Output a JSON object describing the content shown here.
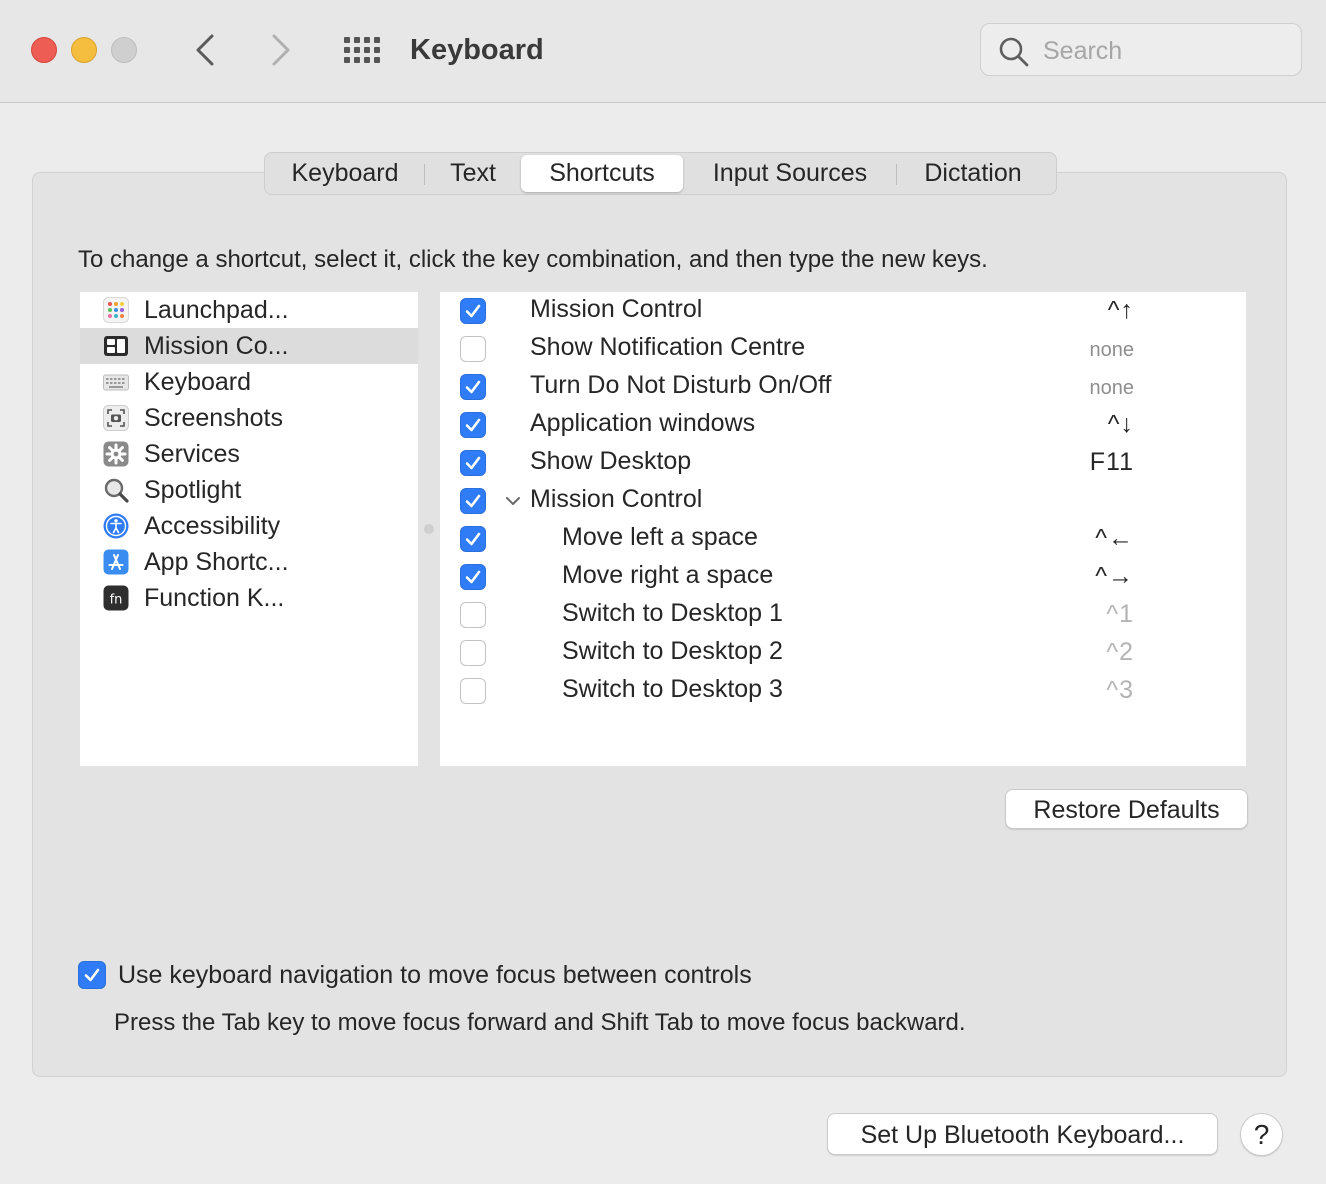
{
  "window": {
    "title": "Keyboard",
    "search_placeholder": "Search"
  },
  "tabs": [
    {
      "label": "Keyboard",
      "active": false
    },
    {
      "label": "Text",
      "active": false
    },
    {
      "label": "Shortcuts",
      "active": true
    },
    {
      "label": "Input Sources",
      "active": false
    },
    {
      "label": "Dictation",
      "active": false
    }
  ],
  "instructions": "To change a shortcut, select it, click the key combination, and then type the new keys.",
  "categories": [
    {
      "label": "Launchpad...",
      "icon": "launchpad-icon",
      "selected": false
    },
    {
      "label": "Mission Co...",
      "icon": "mission-control-icon",
      "selected": true
    },
    {
      "label": "Keyboard",
      "icon": "keyboard-icon",
      "selected": false
    },
    {
      "label": "Screenshots",
      "icon": "screenshot-icon",
      "selected": false
    },
    {
      "label": "Services",
      "icon": "gear-icon",
      "selected": false
    },
    {
      "label": "Spotlight",
      "icon": "magnifier-icon",
      "selected": false
    },
    {
      "label": "Accessibility",
      "icon": "accessibility-icon",
      "selected": false
    },
    {
      "label": "App Shortc...",
      "icon": "app-store-icon",
      "selected": false
    },
    {
      "label": "Function K...",
      "icon": "fn-key-icon",
      "selected": false
    }
  ],
  "shortcuts": [
    {
      "label": "Mission Control",
      "key": "^↑",
      "checked": true,
      "indent": false,
      "group": false,
      "style": "normal"
    },
    {
      "label": "Show Notification Centre",
      "key": "none",
      "checked": false,
      "indent": false,
      "group": false,
      "style": "none"
    },
    {
      "label": "Turn Do Not Disturb On/Off",
      "key": "none",
      "checked": true,
      "indent": false,
      "group": false,
      "style": "none"
    },
    {
      "label": "Application windows",
      "key": "^↓",
      "checked": true,
      "indent": false,
      "group": false,
      "style": "normal"
    },
    {
      "label": "Show Desktop",
      "key": "F11",
      "checked": true,
      "indent": false,
      "group": false,
      "style": "normal"
    },
    {
      "label": "Mission Control",
      "key": "",
      "checked": true,
      "indent": false,
      "group": true,
      "style": "normal"
    },
    {
      "label": "Move left a space",
      "key": "^←",
      "checked": true,
      "indent": true,
      "group": false,
      "style": "normal"
    },
    {
      "label": "Move right a space",
      "key": "^→",
      "checked": true,
      "indent": true,
      "group": false,
      "style": "normal"
    },
    {
      "label": "Switch to Desktop 1",
      "key": "^1",
      "checked": false,
      "indent": true,
      "group": false,
      "style": "dim"
    },
    {
      "label": "Switch to Desktop 2",
      "key": "^2",
      "checked": false,
      "indent": true,
      "group": false,
      "style": "dim"
    },
    {
      "label": "Switch to Desktop 3",
      "key": "^3",
      "checked": false,
      "indent": true,
      "group": false,
      "style": "dim"
    }
  ],
  "buttons": {
    "restore_defaults": "Restore Defaults",
    "bluetooth_setup": "Set Up Bluetooth Keyboard...",
    "help": "?"
  },
  "keyboard_navigation": {
    "checked": true,
    "label": "Use keyboard navigation to move focus between controls",
    "help_text": "Press the Tab key to move focus forward and Shift Tab to move focus backward."
  },
  "colors": {
    "accent": "#2F7CF6",
    "close": "#EE5D53",
    "minimize": "#F5BE3E",
    "zoom_disabled": "#CFCFCF"
  }
}
